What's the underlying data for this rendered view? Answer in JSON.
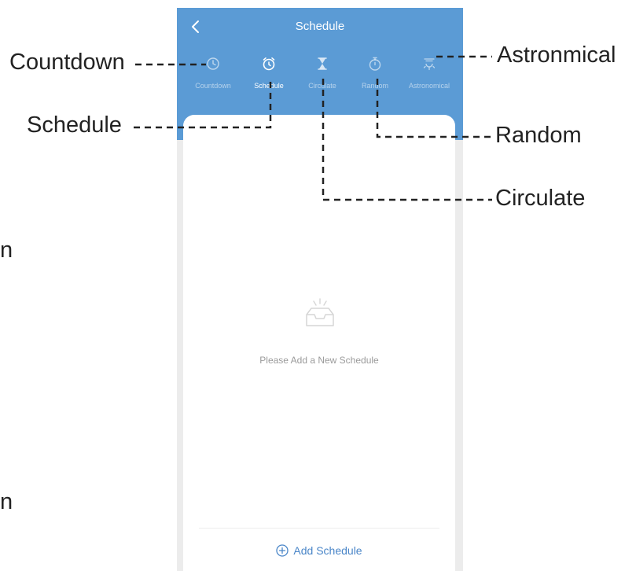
{
  "header": {
    "title": "Schedule",
    "back_icon": "chevron-left-icon"
  },
  "tabs": [
    {
      "label": "Countdown",
      "icon": "clock-icon",
      "active": false
    },
    {
      "label": "Schedule",
      "icon": "alarm-clock-icon",
      "active": true
    },
    {
      "label": "Circulate",
      "icon": "hourglass-icon",
      "active": false
    },
    {
      "label": "Random",
      "icon": "stopwatch-icon",
      "active": false
    },
    {
      "label": "Astronomical",
      "icon": "sun-horizon-icon",
      "active": false
    }
  ],
  "empty_state": {
    "icon": "empty-inbox-icon",
    "text": "Please Add a New Schedule"
  },
  "add_button": {
    "label": "Add Schedule",
    "icon": "plus-circle-icon"
  },
  "callouts": {
    "countdown": "Countdown",
    "schedule": "Schedule",
    "astronomical": "Astronmical",
    "random": "Random",
    "circulate": "Circulate"
  },
  "stray": {
    "top": "n",
    "bottom": "n"
  },
  "colors": {
    "header": "#5b9bd5",
    "background": "#ececec",
    "accent": "#4a86c8"
  }
}
